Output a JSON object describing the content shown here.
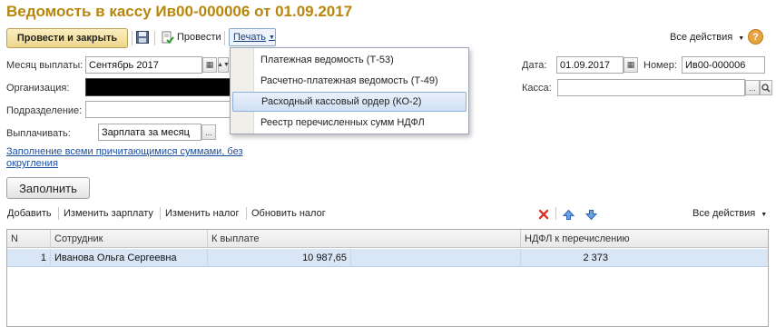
{
  "window": {
    "title": "Ведомость в кассу Ив00-000006 от 01.09.2017"
  },
  "toolbar": {
    "post_close": "Провести и закрыть",
    "post": "Провести",
    "print": "Печать",
    "all_actions": "Все действия",
    "help": "?"
  },
  "print_menu": {
    "items": [
      {
        "label": "Платежная ведомость (Т-53)"
      },
      {
        "label": "Расчетно-платежная ведомость (Т-49)"
      },
      {
        "label": "Расходный кассовый ордер (КО-2)",
        "selected": true
      },
      {
        "label": "Реестр перечисленных сумм НДФЛ"
      }
    ]
  },
  "form": {
    "month_label": "Месяц выплаты:",
    "month_value": "Сентябрь 2017",
    "org_label": "Организация:",
    "org_value": "",
    "dept_label": "Подразделение:",
    "dept_value": "",
    "pay_label": "Выплачивать:",
    "pay_value": "Зарплата за месяц",
    "date_label": "Дата:",
    "date_value": "01.09.2017",
    "number_label": "Номер:",
    "number_value": "Ив00-000006",
    "cash_label": "Касса:",
    "cash_value": "",
    "fill_link": "Заполнение всеми причитающимися суммами, без округления",
    "fill_button": "Заполнить"
  },
  "table_toolbar": {
    "add": "Добавить",
    "change_salary": "Изменить зарплату",
    "change_tax": "Изменить налог",
    "update_tax": "Обновить налог",
    "all_actions": "Все действия"
  },
  "table": {
    "columns": [
      "N",
      "Сотрудник",
      "К выплате",
      "НДФЛ к перечислению"
    ],
    "rows": [
      {
        "n": "1",
        "employee": "Иванова Ольга Сергеевна",
        "amount": "10 987,65",
        "ndfl": "2 373"
      }
    ]
  },
  "colors": {
    "title": "#b8860b",
    "accent_button": "#eed68a",
    "selection": "#d8e6f6",
    "link": "#1a4fa0",
    "delete_icon": "#d9342b",
    "arrow_icon": "#3a7bd5"
  }
}
